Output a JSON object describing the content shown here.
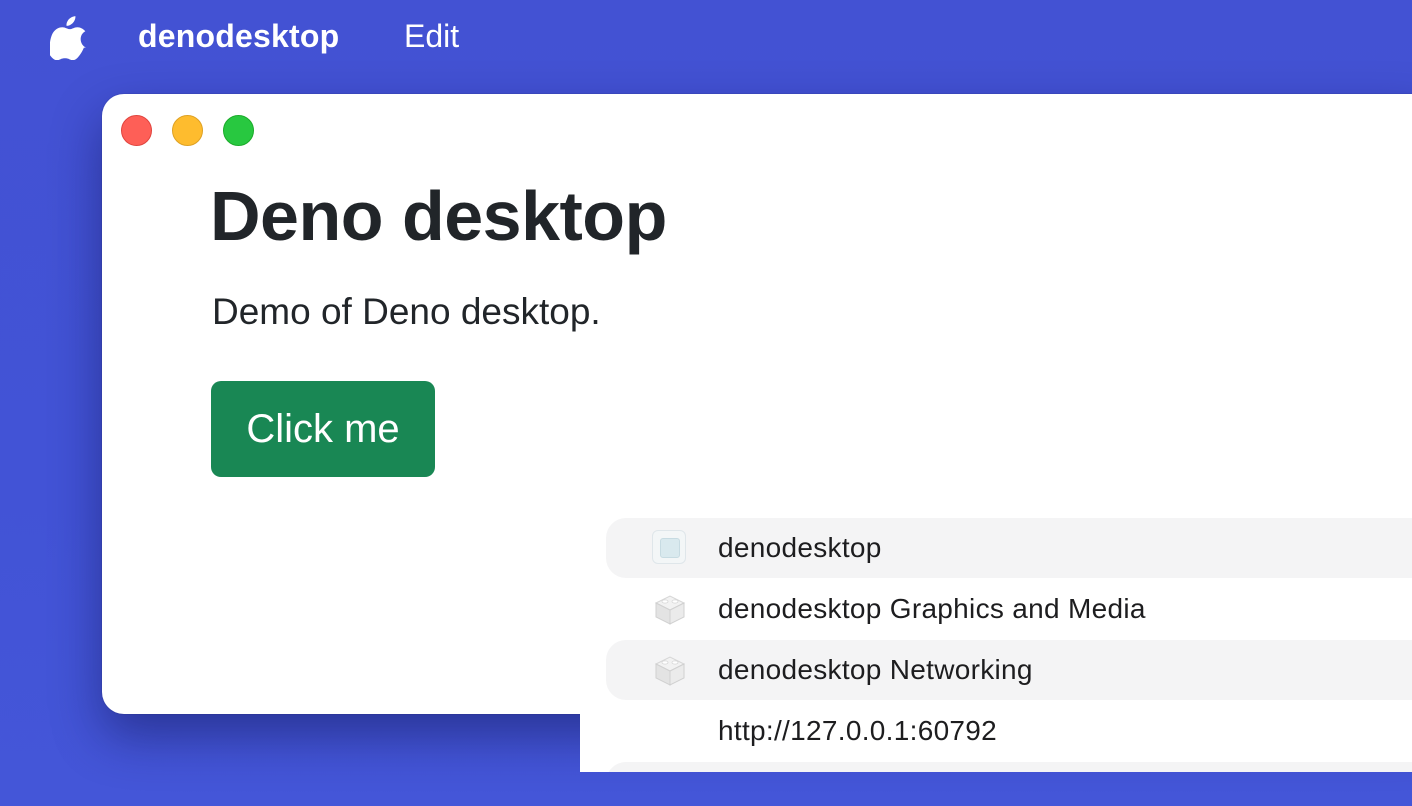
{
  "menubar": {
    "app_name": "denodesktop",
    "menus": [
      "Edit"
    ],
    "apple_icon": "apple-logo-icon"
  },
  "window": {
    "controls": [
      "close",
      "minimize",
      "zoom"
    ],
    "control_colors": {
      "close": "#fe5f57",
      "minimize": "#febc2e",
      "zoom": "#28c840"
    },
    "title": "Deno desktop",
    "lead": "Demo of Deno desktop.",
    "button_label": "Click me",
    "button_color": "#198754"
  },
  "process_list": {
    "rows": [
      {
        "label": "denodesktop",
        "icon": "app-window-icon"
      },
      {
        "label": "denodesktop Graphics and Media",
        "icon": "framework-bundle-icon"
      },
      {
        "label": "denodesktop Networking",
        "icon": "framework-bundle-icon"
      },
      {
        "label": "http://127.0.0.1:60792",
        "icon": ""
      }
    ]
  },
  "colors": {
    "desktop_background": "#4352d3",
    "window_background": "#ffffff",
    "text": "#212529",
    "row_highlight": "#f4f4f5"
  }
}
